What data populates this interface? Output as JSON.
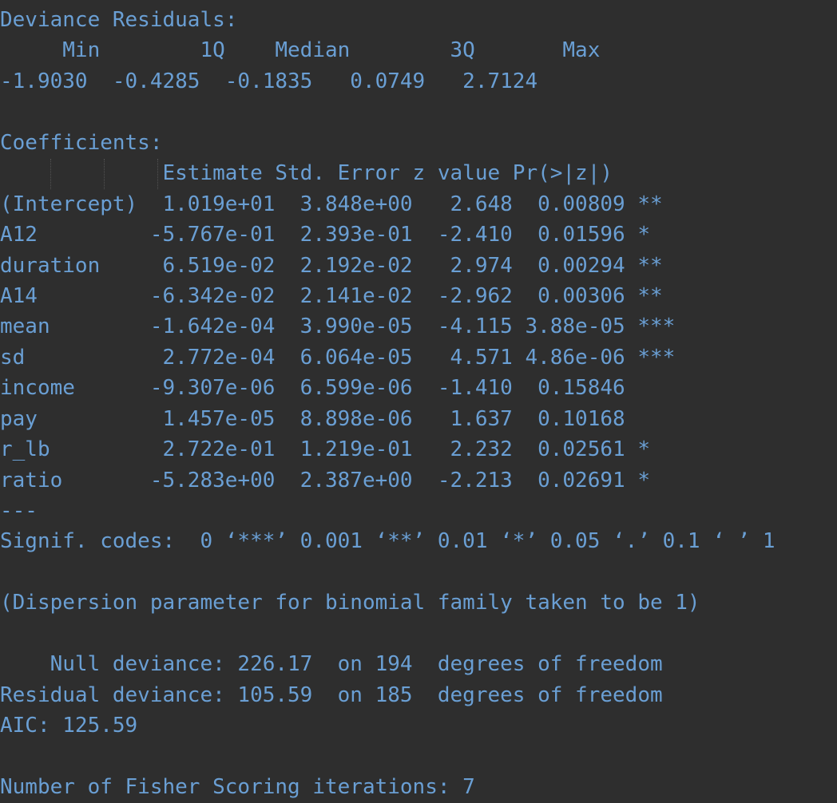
{
  "theme": {
    "background_color": "#2e2e2e",
    "text_color": "#6a9fd4",
    "indent_guide_color": "#5a5a5a"
  },
  "output": {
    "title": "R glm() summary output",
    "deviance_residuals": {
      "heading": "Deviance Residuals:",
      "columns": [
        "Min",
        "1Q",
        "Median",
        "3Q",
        "Max"
      ],
      "values": [
        "-1.9030",
        "-0.4285",
        "-0.1835",
        "0.0749",
        "2.7124"
      ],
      "header_line": "     Min        1Q    Median        3Q       Max  ",
      "value_line": "-1.9030  -0.4285  -0.1835   0.0749   2.7124  "
    },
    "coefficients": {
      "heading": "Coefficients:",
      "columns": [
        "Estimate",
        "Std. Error",
        "z value",
        "Pr(>|z|)"
      ],
      "header_line": "             Estimate Std. Error z value Pr(>|z|)    ",
      "rows": [
        {
          "term": "(Intercept)",
          "estimate": "1.019e+01",
          "std_error": "3.848e+00",
          "z_value": "2.648",
          "p_value": "0.00809",
          "signif": "**",
          "line": "(Intercept)  1.019e+01  3.848e+00   2.648  0.00809 ** "
        },
        {
          "term": "A12",
          "estimate": "-5.767e-01",
          "std_error": "2.393e-01",
          "z_value": "-2.410",
          "p_value": "0.01596",
          "signif": "*",
          "line": "A12         -5.767e-01  2.393e-01  -2.410  0.01596 *  "
        },
        {
          "term": "duration",
          "estimate": "6.519e-02",
          "std_error": "2.192e-02",
          "z_value": "2.974",
          "p_value": "0.00294",
          "signif": "**",
          "line": "duration     6.519e-02  2.192e-02   2.974  0.00294 ** "
        },
        {
          "term": "A14",
          "estimate": "-6.342e-02",
          "std_error": "2.141e-02",
          "z_value": "-2.962",
          "p_value": "0.00306",
          "signif": "**",
          "line": "A14         -6.342e-02  2.141e-02  -2.962  0.00306 ** "
        },
        {
          "term": "mean",
          "estimate": "-1.642e-04",
          "std_error": "3.990e-05",
          "z_value": "-4.115",
          "p_value": "3.88e-05",
          "signif": "***",
          "line": "mean        -1.642e-04  3.990e-05  -4.115 3.88e-05 ***"
        },
        {
          "term": "sd",
          "estimate": "2.772e-04",
          "std_error": "6.064e-05",
          "z_value": "4.571",
          "p_value": "4.86e-06",
          "signif": "***",
          "line": "sd           2.772e-04  6.064e-05   4.571 4.86e-06 ***"
        },
        {
          "term": "income",
          "estimate": "-9.307e-06",
          "std_error": "6.599e-06",
          "z_value": "-1.410",
          "p_value": "0.15846",
          "signif": "",
          "line": "income      -9.307e-06  6.599e-06  -1.410  0.15846    "
        },
        {
          "term": "pay",
          "estimate": "1.457e-05",
          "std_error": "8.898e-06",
          "z_value": "1.637",
          "p_value": "0.10168",
          "signif": "",
          "line": "pay          1.457e-05  8.898e-06   1.637  0.10168    "
        },
        {
          "term": "r_lb",
          "estimate": "2.722e-01",
          "std_error": "1.219e-01",
          "z_value": "2.232",
          "p_value": "0.02561",
          "signif": "*",
          "line": "r_lb         2.722e-01  1.219e-01   2.232  0.02561 *  "
        },
        {
          "term": "ratio",
          "estimate": "-5.283e+00",
          "std_error": "2.387e+00",
          "z_value": "-2.213",
          "p_value": "0.02691",
          "signif": "*",
          "line": "ratio       -5.283e+00  2.387e+00  -2.213  0.02691 *  "
        }
      ]
    },
    "separator": "---",
    "signif_codes_line": "Signif. codes:  0 ‘***’ 0.001 ‘**’ 0.01 ‘*’ 0.05 ‘.’ 0.1 ‘ ’ 1",
    "dispersion_line": "(Dispersion parameter for binomial family taken to be 1)",
    "fit": {
      "null_deviance_line": "    Null deviance: 226.17  on 194  degrees of freedom",
      "residual_deviance_line": "Residual deviance: 105.59  on 185  degrees of freedom",
      "aic_line": "AIC: 125.59",
      "null_deviance": "226.17",
      "null_df": "194",
      "residual_deviance": "105.59",
      "residual_df": "185",
      "aic": "125.59"
    },
    "fisher_line": "Number of Fisher Scoring iterations: 7",
    "fisher_iterations": "7",
    "blank": ""
  }
}
